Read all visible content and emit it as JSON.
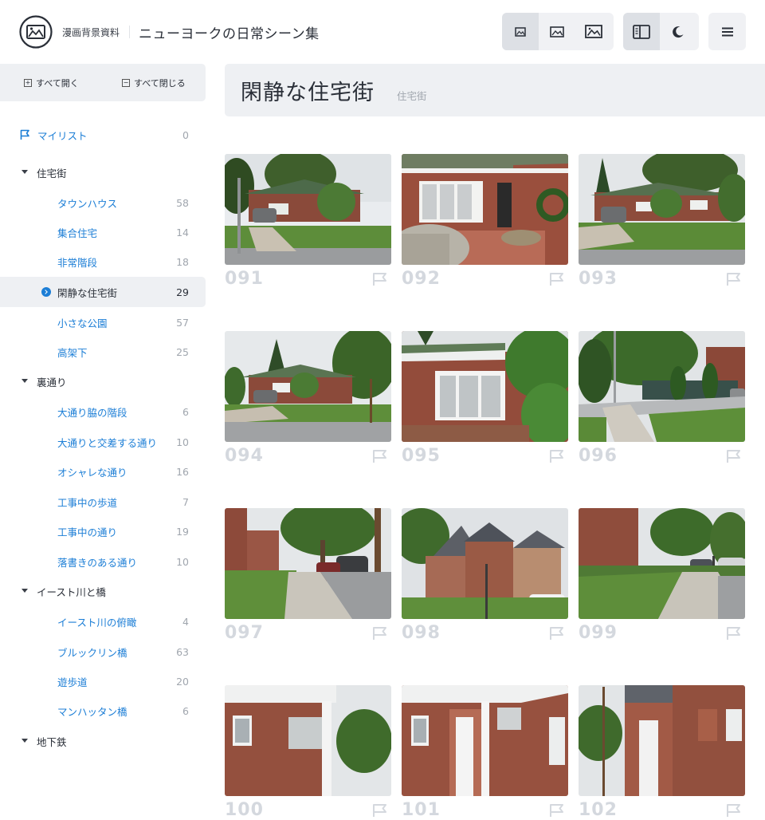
{
  "header": {
    "site_name": "漫画背景資料",
    "collection_title": "ニューヨークの日常シーン集"
  },
  "sidebar": {
    "expand_all": "すべて開く",
    "collapse_all": "すべて閉じる",
    "mylist": {
      "label": "マイリスト",
      "count": "0"
    },
    "groups": [
      {
        "label": "住宅街",
        "items": [
          {
            "label": "タウンハウス",
            "count": "58"
          },
          {
            "label": "集合住宅",
            "count": "14"
          },
          {
            "label": "非常階段",
            "count": "18"
          },
          {
            "label": "閑静な住宅街",
            "count": "29"
          },
          {
            "label": "小さな公園",
            "count": "57"
          },
          {
            "label": "高架下",
            "count": "25"
          }
        ]
      },
      {
        "label": "裏通り",
        "items": [
          {
            "label": "大通り脇の階段",
            "count": "6"
          },
          {
            "label": "大通りと交差する通り",
            "count": "10"
          },
          {
            "label": "オシャレな通り",
            "count": "16"
          },
          {
            "label": "工事中の歩道",
            "count": "7"
          },
          {
            "label": "工事中の通り",
            "count": "19"
          },
          {
            "label": "落書きのある通り",
            "count": "10"
          }
        ]
      },
      {
        "label": "イースト川と橋",
        "items": [
          {
            "label": "イースト川の俯瞰",
            "count": "4"
          },
          {
            "label": "ブルックリン橋",
            "count": "63"
          },
          {
            "label": "遊歩道",
            "count": "20"
          },
          {
            "label": "マンハッタン橋",
            "count": "6"
          }
        ]
      },
      {
        "label": "地下鉄",
        "items": []
      }
    ]
  },
  "main": {
    "title": "閑静な住宅街",
    "subtitle": "住宅街",
    "photos": [
      {
        "number": "091"
      },
      {
        "number": "092"
      },
      {
        "number": "093"
      },
      {
        "number": "094"
      },
      {
        "number": "095"
      },
      {
        "number": "096"
      },
      {
        "number": "097"
      },
      {
        "number": "098"
      },
      {
        "number": "099"
      },
      {
        "number": "100"
      },
      {
        "number": "101"
      },
      {
        "number": "102"
      }
    ]
  },
  "icons": {
    "logo": "picture-frame-icon",
    "size_buttons": [
      "image-small-icon",
      "image-medium-icon",
      "image-large-icon"
    ],
    "sidebar_toggle": "sidebar-icon",
    "dark_mode": "moon-icon",
    "menu": "hamburger-icon",
    "flag": "flag-icon"
  },
  "colors": {
    "accent": "#1c7ed6",
    "panel": "#eef0f3",
    "number": "#d4d8de"
  }
}
